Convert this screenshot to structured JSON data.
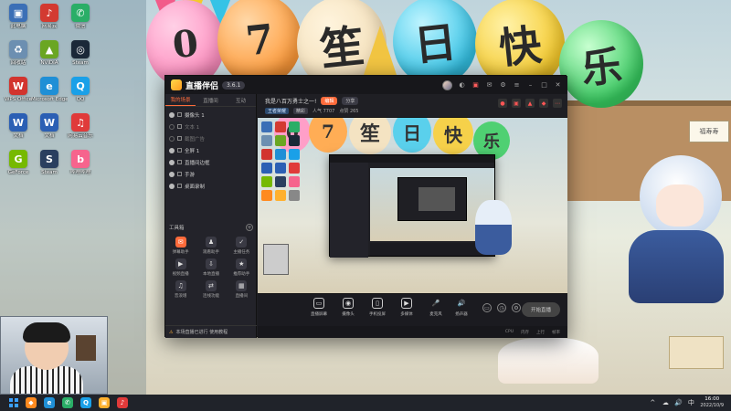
{
  "wallpaper": {
    "balloons": [
      "0",
      "7",
      "笙",
      "日",
      "快",
      "乐"
    ],
    "sign_text": "福寿寿"
  },
  "desktop": {
    "icons": [
      {
        "label": "此电脑",
        "glyph": "▣",
        "color": "#3b6fb6"
      },
      {
        "label": "网易云",
        "glyph": "♪",
        "color": "#d33a31"
      },
      {
        "label": "微信",
        "glyph": "✆",
        "color": "#2aae67"
      },
      {
        "label": "回收站",
        "glyph": "♻",
        "color": "#6c8fb1"
      },
      {
        "label": "NVIDIA",
        "glyph": "▲",
        "color": "#6aa622"
      },
      {
        "label": "Steam",
        "glyph": "◎",
        "color": "#1b2838"
      },
      {
        "label": "WPS Office",
        "glyph": "W",
        "color": "#d2342e"
      },
      {
        "label": "Microsoft Edge",
        "glyph": "e",
        "color": "#1f8fd6"
      },
      {
        "label": "QQ",
        "glyph": "Q",
        "color": "#1aa0e8"
      },
      {
        "label": "文档",
        "glyph": "W",
        "color": "#2b5fb4"
      },
      {
        "label": "文档",
        "glyph": "W",
        "color": "#2b5fb4"
      },
      {
        "label": "网易云音乐",
        "glyph": "♫",
        "color": "#e03a3a"
      },
      {
        "label": "GeForce",
        "glyph": "G",
        "color": "#76b900"
      },
      {
        "label": "Steam",
        "glyph": "S",
        "color": "#2a3f5f"
      },
      {
        "label": "哔哩哔哩",
        "glyph": "b",
        "color": "#f6648d"
      }
    ]
  },
  "app": {
    "title": "直播伴侣",
    "version": "3.6.1",
    "sidebar": {
      "tabs": [
        "我的场景",
        "直播间",
        "互动"
      ],
      "scenes": [
        {
          "label": "摄像头 1",
          "visible": true
        },
        {
          "label": "文本 1",
          "visible": false
        },
        {
          "label": "截图广告",
          "visible": false
        },
        {
          "label": "全屏 1",
          "visible": true
        },
        {
          "label": "直播间边框",
          "visible": true
        },
        {
          "label": "手游",
          "visible": true
        },
        {
          "label": "桌面录制",
          "visible": true
        }
      ],
      "tools_title": "工具箱",
      "tools": [
        {
          "label": "弹幕助手",
          "glyph": "✉",
          "hot": true
        },
        {
          "label": "观看助手",
          "glyph": "♟",
          "hot": false
        },
        {
          "label": "主播任务",
          "glyph": "✓",
          "hot": false
        },
        {
          "label": "视频直播",
          "glyph": "▶",
          "hot": false
        },
        {
          "label": "本地直播",
          "glyph": "⇩",
          "hot": false
        },
        {
          "label": "推荐助手",
          "glyph": "★",
          "hot": false
        },
        {
          "label": "音浪增",
          "glyph": "♫",
          "hot": false
        },
        {
          "label": "连线功能",
          "glyph": "⇄",
          "hot": false
        },
        {
          "label": "直播间",
          "glyph": "▦",
          "hot": false
        }
      ],
      "footer": "本场直播已进行 使用教程"
    },
    "header": {
      "room_title": "我是八百万勇士之一!",
      "edit": "编辑",
      "share": "分享",
      "category": "王者荣耀",
      "tag": "精彩",
      "viewers": "人气 7707",
      "likes": "点赞 265"
    },
    "controls": [
      {
        "label": "直播屏幕",
        "glyph": "▭"
      },
      {
        "label": "摄像头",
        "glyph": "◉"
      },
      {
        "label": "手机投屏",
        "glyph": "▯"
      },
      {
        "label": "多媒体",
        "glyph": "▶"
      },
      {
        "label": "麦克风",
        "glyph": "🎤"
      },
      {
        "label": "扬声器",
        "glyph": "🔊"
      }
    ],
    "start_label": "开始直播",
    "status": [
      "CPU",
      "内存",
      "上行",
      "帧率"
    ]
  },
  "taskbar": {
    "apps": [
      {
        "glyph": "◆",
        "color": "#ff8a1f"
      },
      {
        "glyph": "e",
        "color": "#1f8fd6"
      },
      {
        "glyph": "✆",
        "color": "#2aae67"
      },
      {
        "glyph": "Q",
        "color": "#1aa0e8"
      },
      {
        "glyph": "▣",
        "color": "#ffb02e"
      },
      {
        "glyph": "♪",
        "color": "#e03a3a"
      }
    ],
    "time": "16:00",
    "date": "2022/10/9",
    "tray_glyphs": [
      "^",
      "☁",
      "🔊",
      "中"
    ]
  }
}
